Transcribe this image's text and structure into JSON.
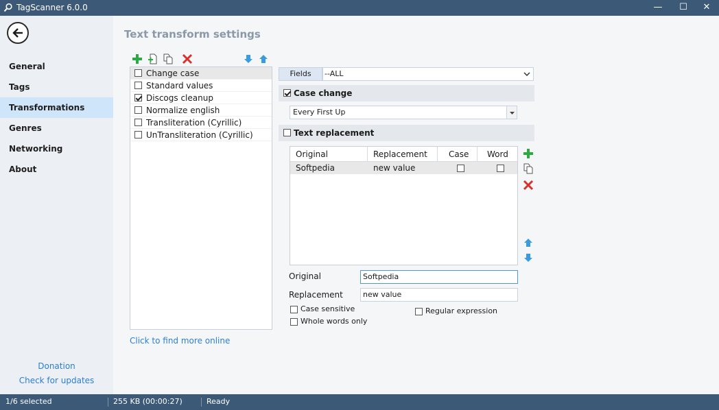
{
  "window": {
    "title": "TagScanner 6.0.0",
    "minimize_glyph": "—",
    "maximize_glyph": "☐",
    "close_glyph": "✕"
  },
  "sidebar": {
    "items": [
      {
        "label": "General",
        "active": false
      },
      {
        "label": "Tags",
        "active": false
      },
      {
        "label": "Transformations",
        "active": true
      },
      {
        "label": "Genres",
        "active": false
      },
      {
        "label": "Networking",
        "active": false
      },
      {
        "label": "About",
        "active": false
      }
    ],
    "donation_label": "Donation",
    "updates_label": "Check for updates"
  },
  "page": {
    "title": "Text transform settings"
  },
  "transforms": {
    "items": [
      {
        "label": "Change case",
        "checked": false,
        "selected": true
      },
      {
        "label": "Standard values",
        "checked": false,
        "selected": false
      },
      {
        "label": "Discogs cleanup",
        "checked": true,
        "selected": false
      },
      {
        "label": "Normalize english",
        "checked": false,
        "selected": false
      },
      {
        "label": "Transliteration (Cyrillic)",
        "checked": false,
        "selected": false
      },
      {
        "label": "UnTransliteration (Cyrillic)",
        "checked": false,
        "selected": false
      }
    ],
    "find_more_label": "Click to find more online"
  },
  "fields": {
    "label": "Fields",
    "value": "--ALL"
  },
  "case_change": {
    "label": "Case change",
    "checked": true,
    "mode": "Every First Up"
  },
  "text_replacement": {
    "label": "Text replacement",
    "checked": false,
    "columns": [
      "Original",
      "Replacement",
      "Case",
      "Word"
    ],
    "rows": [
      {
        "original": "Softpedia",
        "replacement": "new value",
        "case": false,
        "word": false
      }
    ]
  },
  "editor": {
    "original_label": "Original",
    "original_value": "Softpedia",
    "replacement_label": "Replacement",
    "replacement_value": "new value",
    "case_sensitive_label": "Case sensitive",
    "whole_words_label": "Whole words only",
    "regex_label": "Regular expression"
  },
  "status": {
    "selected": "1/6 selected",
    "size": "255 KB (00:00:27)",
    "state": "Ready"
  },
  "colors": {
    "titlebar": "#3c5a78",
    "accent_link": "#2a7fd4",
    "active_nav": "#cfe5fa",
    "add_green": "#2ea843",
    "delete_red": "#d9302a",
    "arrow_blue": "#3a9be0"
  }
}
